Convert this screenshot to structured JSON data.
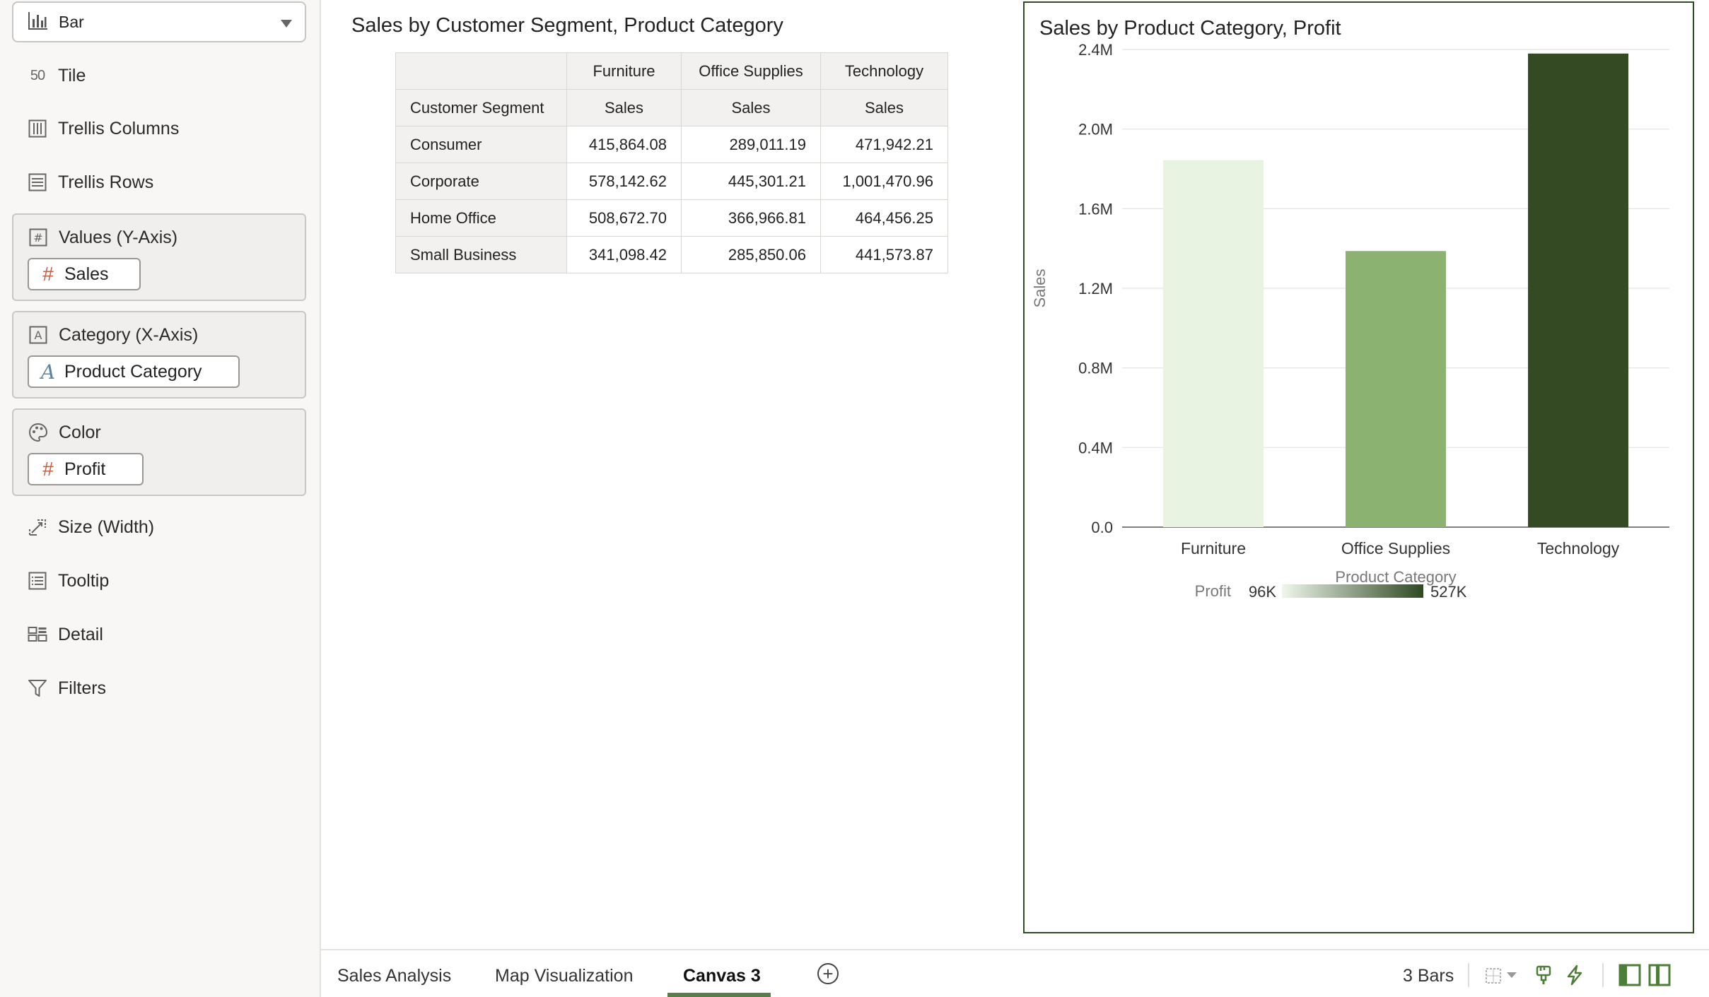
{
  "grammar_panel": {
    "viz_type": "Bar",
    "items": {
      "tile": "Tile",
      "trellis_columns": "Trellis Columns",
      "trellis_rows": "Trellis Rows",
      "values_y": "Values (Y-Axis)",
      "values_y_pill": "Sales",
      "category_x": "Category (X-Axis)",
      "category_x_pill": "Product Category",
      "color": "Color",
      "color_pill": "Profit",
      "size": "Size (Width)",
      "tooltip": "Tooltip",
      "detail": "Detail",
      "filters": "Filters"
    },
    "tile_icon_text": "50"
  },
  "pivot_table": {
    "title": "Sales by Customer Segment, Product Category",
    "row_header": "Customer Segment",
    "columns": [
      "Furniture",
      "Office Supplies",
      "Technology"
    ],
    "measure_labels": [
      "Sales",
      "Sales",
      "Sales"
    ],
    "rows": [
      {
        "segment": "Consumer",
        "values": [
          "415,864.08",
          "289,011.19",
          "471,942.21"
        ]
      },
      {
        "segment": "Corporate",
        "values": [
          "578,142.62",
          "445,301.21",
          "1,001,470.96"
        ]
      },
      {
        "segment": "Home Office",
        "values": [
          "508,672.70",
          "366,966.81",
          "464,456.25"
        ]
      },
      {
        "segment": "Small Business",
        "values": [
          "341,098.42",
          "285,850.06",
          "441,573.87"
        ]
      }
    ]
  },
  "chart_data": {
    "type": "bar",
    "title": "Sales by Product Category, Profit",
    "xlabel": "Product Category",
    "ylabel": "Sales",
    "categories": [
      "Furniture",
      "Office Supplies",
      "Technology"
    ],
    "values": [
      1843777.82,
      1387129.27,
      2379443.29
    ],
    "bar_colors": [
      "#e8f3e2",
      "#8cb272",
      "#334a23"
    ],
    "ylim": [
      0,
      2400000
    ],
    "yticks": [
      0,
      400000,
      800000,
      1200000,
      1600000,
      2000000,
      2400000
    ],
    "ytick_labels": [
      "0.0",
      "0.4M",
      "0.8M",
      "1.2M",
      "1.6M",
      "2.0M",
      "2.4M"
    ],
    "grid": true,
    "legend": {
      "title": "Profit",
      "min_label": "96K",
      "max_label": "527K",
      "gradient": [
        "#f0f6ec",
        "#2f4a22"
      ]
    }
  },
  "bottom_bar": {
    "tabs": [
      "Sales Analysis",
      "Map Visualization",
      "Canvas 3"
    ],
    "active_tab": "Canvas 3",
    "status": "3 Bars"
  }
}
